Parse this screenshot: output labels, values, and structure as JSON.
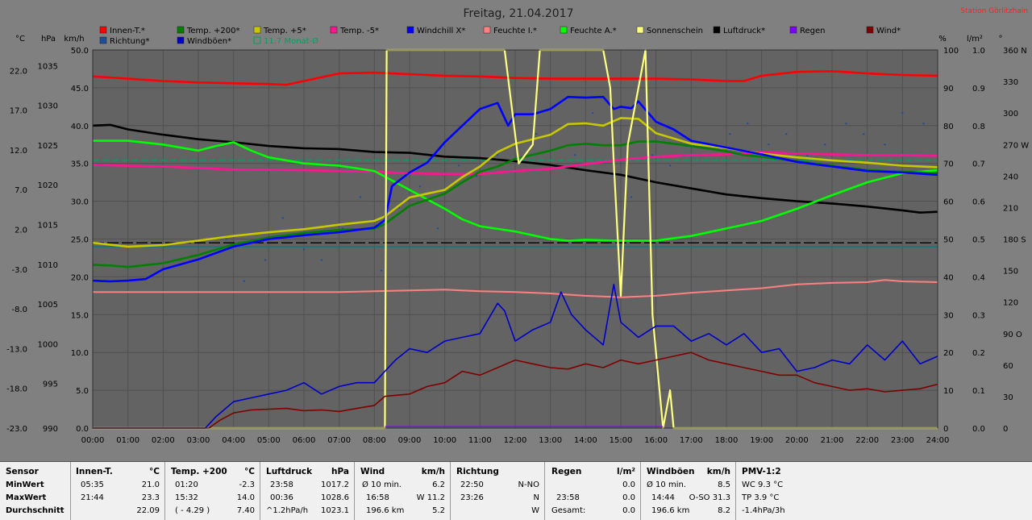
{
  "header": {
    "title": "Freitag, 21.04.2017",
    "station": "Station Görlitzhain"
  },
  "colors": {
    "plot_bg": "#636363",
    "grid": "#505050",
    "innen": "#ff0000",
    "temp200": "#008000",
    "temp5": "#c8c800",
    "tempm5": "#ff1493",
    "windchill": "#0000ff",
    "feuchte_i": "#ff8080",
    "feuchte_a": "#00ff00",
    "sonne": "#ffff80",
    "luftdruck": "#000000",
    "regen": "#8000ff",
    "wind": "#800000",
    "richtung": "#1e4e9a",
    "windboeen": "#0000c8",
    "monat": "#00a060"
  },
  "legend": [
    {
      "label": "Innen-T.*",
      "color": "#ff0000"
    },
    {
      "label": "Temp. +200*",
      "color": "#008000"
    },
    {
      "label": "Temp. +5*",
      "color": "#c8c800"
    },
    {
      "label": "Temp. -5*",
      "color": "#ff1493"
    },
    {
      "label": "Windchill X*",
      "color": "#0000ff"
    },
    {
      "label": "Feuchte I.*",
      "color": "#ff8080"
    },
    {
      "label": "Feuchte A.*",
      "color": "#00ff00"
    },
    {
      "label": "Sonnenschein",
      "color": "#ffff80"
    },
    {
      "label": "Luftdruck*",
      "color": "#000000"
    },
    {
      "label": "Regen",
      "color": "#8000ff"
    },
    {
      "label": "Wind*",
      "color": "#800000"
    },
    {
      "label": "Richtung*",
      "color": "#1e4e9a"
    },
    {
      "label": "Windböen*",
      "color": "#0000c8"
    },
    {
      "label": "11.7 Monat-Ø",
      "color": "#00a060",
      "hollow": true
    }
  ],
  "axes": {
    "unit_c": "°C",
    "unit_hpa": "hPa",
    "unit_kmh": "km/h",
    "unit_pct": "%",
    "unit_lm2": "l/m²",
    "unit_deg": "°",
    "c_ticks": [
      "22.0",
      "17.0",
      "12.0",
      "7.0",
      "2.0",
      "-3.0",
      "-8.0",
      "-13.0",
      "-18.0",
      "-23.0"
    ],
    "hpa_ticks": [
      "1035",
      "1030",
      "1025",
      "1020",
      "1015",
      "1010",
      "1005",
      "1000",
      "995",
      "990"
    ],
    "kmh_ticks": [
      "50.0",
      "45.0",
      "40.0",
      "35.0",
      "30.0",
      "25.0",
      "20.0",
      "15.0",
      "10.0",
      "5.0",
      "0.0"
    ],
    "pct_ticks": [
      "100",
      "90",
      "80",
      "70",
      "60",
      "50",
      "40",
      "30",
      "20",
      "10",
      "0"
    ],
    "lm2_ticks": [
      "1.0",
      "0.9",
      "0.8",
      "0.7",
      "0.6",
      "0.5",
      "0.4",
      "0.3",
      "0.2",
      "0.1",
      "0.0"
    ],
    "deg_ticks": [
      "360 N",
      "330",
      "300",
      "270 W",
      "240",
      "210",
      "180 S",
      "150",
      "120",
      "90 O",
      "60",
      "30",
      "0"
    ],
    "time_ticks": [
      "00:00",
      "01:00",
      "02:00",
      "03:00",
      "04:00",
      "05:00",
      "06:00",
      "07:00",
      "08:00",
      "09:00",
      "10:00",
      "11:00",
      "12:00",
      "13:00",
      "14:00",
      "15:00",
      "16:00",
      "17:00",
      "18:00",
      "19:00",
      "20:00",
      "21:00",
      "22:00",
      "23:00",
      "24:00"
    ]
  },
  "chart_data": {
    "type": "line",
    "x_unit": "hours",
    "kmh_range": [
      0,
      50
    ],
    "pct_range": [
      0,
      100
    ],
    "deg_range": [
      0,
      360
    ],
    "series": [
      {
        "name": "Innen-T.*",
        "axis": "kmh",
        "color": "#ff0000",
        "x": [
          0,
          1,
          2,
          3,
          4,
          5,
          5.5,
          6,
          7,
          8,
          9,
          10,
          11,
          12,
          13,
          14,
          15,
          16,
          17,
          18,
          18.5,
          19,
          20,
          21,
          22,
          23,
          24
        ],
        "y": [
          46.5,
          46.2,
          45.9,
          45.7,
          45.6,
          45.5,
          45.4,
          45.9,
          46.9,
          47.0,
          46.8,
          46.6,
          46.5,
          46.3,
          46.2,
          46.2,
          46.2,
          46.2,
          46.1,
          45.9,
          45.9,
          46.6,
          47.1,
          47.2,
          46.9,
          46.7,
          46.6
        ]
      },
      {
        "name": "Luftdruck*",
        "axis": "kmh",
        "color": "#000000",
        "x": [
          0,
          0.5,
          1,
          2,
          3,
          4,
          5,
          6,
          7,
          8,
          9,
          10,
          11,
          12,
          13,
          14,
          15,
          16,
          17,
          18,
          19,
          20,
          21,
          22,
          23,
          23.5,
          24
        ],
        "y": [
          40.0,
          40.1,
          39.5,
          38.8,
          38.2,
          37.8,
          37.3,
          37.0,
          36.9,
          36.5,
          36.4,
          35.9,
          35.7,
          35.3,
          34.8,
          34.1,
          33.5,
          32.5,
          31.7,
          30.9,
          30.4,
          30.0,
          29.7,
          29.3,
          28.8,
          28.5,
          28.6
        ]
      },
      {
        "name": "Temp. -5*",
        "axis": "kmh",
        "color": "#ff1493",
        "x": [
          0,
          2,
          4,
          6,
          8,
          9,
          10,
          11,
          12,
          13,
          14,
          15,
          16,
          17,
          18,
          19,
          20,
          21,
          22,
          23,
          24
        ],
        "y": [
          34.8,
          34.6,
          34.2,
          34.1,
          33.9,
          33.7,
          33.6,
          33.6,
          34.0,
          34.3,
          34.9,
          35.5,
          35.9,
          36.1,
          36.2,
          36.5,
          36.3,
          36.2,
          36.1,
          36.1,
          36.0
        ]
      },
      {
        "name": "Feuchte A.*",
        "axis": "kmh",
        "color": "#00ff00",
        "x": [
          0,
          1,
          2,
          3,
          3.5,
          4,
          4.5,
          5,
          6,
          7,
          8,
          9,
          10,
          10.5,
          11,
          12,
          13,
          13.5,
          14,
          15,
          16,
          17,
          18,
          19,
          20,
          21,
          22,
          23,
          24
        ],
        "y": [
          38.0,
          38.0,
          37.5,
          36.7,
          37.3,
          37.8,
          36.7,
          35.8,
          35.0,
          34.7,
          34.0,
          31.5,
          29.0,
          27.6,
          26.7,
          26.0,
          25.0,
          24.8,
          24.9,
          24.8,
          24.8,
          25.4,
          26.4,
          27.4,
          29.0,
          30.8,
          32.5,
          33.7,
          34.1
        ]
      },
      {
        "name": "Feuchte I.*",
        "axis": "kmh",
        "color": "#ff8080",
        "x": [
          0,
          1,
          2,
          3,
          4,
          5,
          6,
          7,
          8,
          9,
          10,
          11,
          12,
          13,
          14,
          15,
          16,
          17,
          18,
          19,
          20,
          21,
          22,
          22.5,
          23,
          24
        ],
        "y": [
          18.0,
          18.0,
          18.0,
          18.0,
          18.0,
          18.0,
          18.0,
          18.0,
          18.1,
          18.2,
          18.3,
          18.1,
          18.0,
          17.8,
          17.5,
          17.3,
          17.5,
          17.9,
          18.2,
          18.5,
          19.0,
          19.2,
          19.3,
          19.6,
          19.4,
          19.3
        ]
      },
      {
        "name": "Temp. +5*",
        "axis": "kmh",
        "color": "#c8c800",
        "x": [
          0,
          1,
          2,
          3,
          4,
          5,
          6,
          7,
          8,
          8.3,
          9,
          9.5,
          10,
          10.5,
          11,
          11.5,
          12,
          13,
          13.5,
          14,
          14.5,
          15,
          15.5,
          16,
          17,
          18,
          19,
          20,
          21,
          22,
          23,
          24
        ],
        "y": [
          24.5,
          24.0,
          24.2,
          24.8,
          25.4,
          25.9,
          26.3,
          26.9,
          27.4,
          28.0,
          30.5,
          31.0,
          31.5,
          33.2,
          34.6,
          36.5,
          37.6,
          38.8,
          40.2,
          40.3,
          40.0,
          41.0,
          40.9,
          39.0,
          37.6,
          37.0,
          36.3,
          35.8,
          35.4,
          35.1,
          34.7,
          34.5
        ]
      },
      {
        "name": "Temp. +200*",
        "axis": "kmh",
        "color": "#008000",
        "x": [
          0,
          0.5,
          1,
          2,
          3,
          4,
          5,
          6,
          7,
          8,
          8.3,
          9,
          10,
          10.5,
          11,
          11.5,
          12,
          13,
          13.5,
          14,
          14.5,
          15,
          15.5,
          16,
          17,
          18,
          18.5,
          19,
          20,
          21,
          22,
          23,
          24
        ],
        "y": [
          21.6,
          21.5,
          21.3,
          21.8,
          22.9,
          24.3,
          25.2,
          25.8,
          26.2,
          26.4,
          27.0,
          29.4,
          31.0,
          32.5,
          33.9,
          34.6,
          35.6,
          36.7,
          37.4,
          37.6,
          37.4,
          37.4,
          37.9,
          37.9,
          37.3,
          36.6,
          36.1,
          35.9,
          35.3,
          34.7,
          34.1,
          33.9,
          33.7
        ]
      },
      {
        "name": "Windchill X*",
        "axis": "kmh",
        "color": "#0000ff",
        "x": [
          0,
          0.5,
          1,
          1.5,
          2,
          3,
          4,
          5,
          6,
          7,
          8,
          8.3,
          8.5,
          9,
          9.5,
          10,
          10.5,
          11,
          11.5,
          11.8,
          12,
          12.5,
          13,
          13.5,
          14,
          14.5,
          14.8,
          15,
          15.3,
          15.5,
          16,
          16.5,
          17,
          18,
          19,
          20,
          21,
          22,
          23,
          24
        ],
        "y": [
          19.5,
          19.4,
          19.5,
          19.7,
          21.0,
          22.3,
          24.0,
          25.0,
          25.5,
          25.9,
          26.5,
          27.5,
          32.0,
          33.8,
          35.1,
          37.8,
          40.0,
          42.2,
          43.0,
          40.0,
          41.5,
          41.5,
          42.2,
          43.8,
          43.7,
          43.8,
          42.2,
          42.5,
          42.3,
          43.2,
          40.5,
          39.5,
          38.0,
          37.1,
          36.2,
          35.2,
          34.6,
          34.0,
          33.8,
          33.5
        ]
      },
      {
        "name": "Sonnenschein",
        "axis": "pct",
        "color": "#ffff80",
        "x": [
          0,
          8.3,
          8.35,
          8.7,
          8.9,
          9.6,
          11.4,
          11.7,
          12.1,
          12.5,
          12.7,
          14.5,
          14.7,
          14.8,
          15.0,
          15.2,
          15.7,
          15.9,
          16.1,
          16.2,
          16.4,
          16.5,
          24
        ],
        "y": [
          0,
          0,
          100,
          100,
          100,
          100,
          100,
          100,
          70,
          75,
          100,
          100,
          90,
          70,
          35,
          75,
          100,
          30,
          10,
          0,
          10,
          0,
          0
        ]
      },
      {
        "name": "Windböen*",
        "axis": "kmh",
        "color": "#0000c8",
        "x": [
          0,
          3.2,
          3.5,
          4,
          4.5,
          5,
          5.5,
          6,
          6.5,
          7,
          7.5,
          8,
          8.3,
          8.6,
          9,
          9.5,
          10,
          10.5,
          11,
          11.5,
          11.7,
          12,
          12.5,
          13,
          13.3,
          13.6,
          14,
          14.5,
          14.8,
          15,
          15.5,
          16,
          16.5,
          17,
          17.5,
          18,
          18.5,
          19,
          19.5,
          20,
          20.5,
          21,
          21.5,
          22,
          22.5,
          23,
          23.5,
          24
        ],
        "y": [
          0,
          0,
          1.5,
          3.5,
          4.0,
          4.5,
          5.0,
          6.0,
          4.5,
          5.5,
          6.0,
          6.0,
          7.5,
          9.0,
          10.5,
          10.0,
          11.5,
          12.0,
          12.5,
          16.5,
          15.5,
          11.5,
          13.0,
          14.0,
          18.0,
          15.0,
          13.0,
          11.0,
          19.0,
          14.0,
          12.0,
          13.5,
          13.5,
          11.5,
          12.5,
          11.0,
          12.5,
          10.0,
          10.5,
          7.5,
          8.0,
          9.0,
          8.5,
          11.0,
          9.0,
          11.5,
          8.5,
          9.5
        ]
      },
      {
        "name": "Wind*",
        "axis": "kmh",
        "color": "#800000",
        "x": [
          0,
          3.3,
          3.6,
          4,
          4.5,
          5,
          5.5,
          6,
          6.5,
          7,
          7.5,
          8,
          8.3,
          9,
          9.5,
          10,
          10.5,
          11,
          11.5,
          12,
          12.5,
          13,
          13.5,
          14,
          14.5,
          15,
          15.5,
          16,
          16.5,
          17,
          17.5,
          18,
          18.5,
          19,
          19.5,
          20,
          20.5,
          21,
          21.5,
          22,
          22.5,
          23,
          23.5,
          24
        ],
        "y": [
          0,
          0,
          1.0,
          2.0,
          2.4,
          2.5,
          2.6,
          2.3,
          2.4,
          2.2,
          2.6,
          3.0,
          4.2,
          4.5,
          5.5,
          6.0,
          7.5,
          7.0,
          8.0,
          9.0,
          8.5,
          8.0,
          7.8,
          8.5,
          8.0,
          9.0,
          8.5,
          9.0,
          9.5,
          10.0,
          9.0,
          8.5,
          8.0,
          7.5,
          7.0,
          7.0,
          6.0,
          5.5,
          5.0,
          5.2,
          4.8,
          5.0,
          5.2,
          5.8
        ]
      },
      {
        "name": "Regen",
        "axis": "kmh",
        "color": "#8000ff",
        "x": [
          8.3,
          16.2
        ],
        "y": [
          0.2,
          0.2
        ]
      }
    ],
    "reference_lines": [
      {
        "name": "11.7 Monat-Ø",
        "axis": "kmh",
        "value": 35.4,
        "color": "#00a060",
        "dash": "8,4"
      },
      {
        "axis": "kmh",
        "value": 24.5,
        "color": "#000000",
        "dash": "14,4"
      },
      {
        "axis": "kmh",
        "value": 24.0,
        "color": "#008080",
        "dash": ""
      }
    ],
    "direction_points": {
      "axis": "deg",
      "x": [
        3.8,
        4.3,
        4.9,
        5.4,
        6.0,
        6.5,
        7.1,
        7.6,
        8.2,
        8.7,
        9.3,
        9.8,
        10.4,
        10.9,
        11.5,
        12.0,
        12.6,
        13.1,
        13.7,
        14.2,
        14.8,
        15.3,
        15.9,
        16.4,
        17.0,
        17.5,
        18.1,
        18.6,
        19.2,
        19.7,
        20.3,
        20.8,
        21.4,
        21.9,
        22.5,
        23.0,
        23.6
      ],
      "y": [
        180,
        140,
        160,
        200,
        170,
        160,
        190,
        220,
        150,
        210,
        230,
        190,
        250,
        240,
        260,
        270,
        280,
        250,
        260,
        300,
        240,
        220,
        260,
        250,
        270,
        260,
        280,
        290,
        270,
        280,
        260,
        270,
        290,
        280,
        270,
        300,
        290
      ]
    }
  },
  "stats": {
    "rows": [
      "Sensor",
      "MinWert",
      "MaxWert",
      "Durchschnitt"
    ],
    "innen": {
      "h": "Innen-T.",
      "u": "°C",
      "r1": [
        "05:35",
        "21.0"
      ],
      "r2": [
        "21:44",
        "23.3"
      ],
      "r3": [
        "",
        "22.09"
      ]
    },
    "temp": {
      "h": "Temp. +200",
      "u": "°C",
      "r1": [
        "01:20",
        "-2.3"
      ],
      "r2": [
        "15:32",
        "14.0"
      ],
      "r3": [
        "( - 4.29 )",
        "7.40"
      ]
    },
    "druck": {
      "h": "Luftdruck",
      "u": "hPa",
      "r1": [
        "23:58",
        "1017.2"
      ],
      "r2": [
        "00:36",
        "1028.6"
      ],
      "r3": [
        "^1.2hPa/h",
        "1023.1"
      ]
    },
    "wind": {
      "h": "Wind",
      "u": "km/h",
      "r1": [
        "Ø 10 min.",
        "6.2"
      ],
      "r2": [
        "16:58",
        "W 11.2"
      ],
      "r3": [
        "196.6 km",
        "5.2"
      ]
    },
    "richtung": {
      "h": "Richtung",
      "r1": [
        "22:50",
        "N-NO"
      ],
      "r2": [
        "23:26",
        "N"
      ],
      "r3": [
        "",
        "W"
      ]
    },
    "regen": {
      "h": "Regen",
      "u": "l/m²",
      "r1": [
        "",
        "0.0"
      ],
      "r2": [
        "23:58",
        "0.0"
      ],
      "r3": [
        "Gesamt:",
        "0.0"
      ]
    },
    "boeen": {
      "h": "Windböen",
      "u": "km/h",
      "r1": [
        "Ø 10 min.",
        "8.5"
      ],
      "r2": [
        "14:44",
        "O-SO 31.3"
      ],
      "r3": [
        "196.6 km",
        "8.2"
      ]
    },
    "pmv": {
      "h": "PMV-1:2",
      "r1": "WC 9.3 °C",
      "r2": "TP 3.9 °C",
      "r3": "-1.4hPa/3h"
    }
  }
}
